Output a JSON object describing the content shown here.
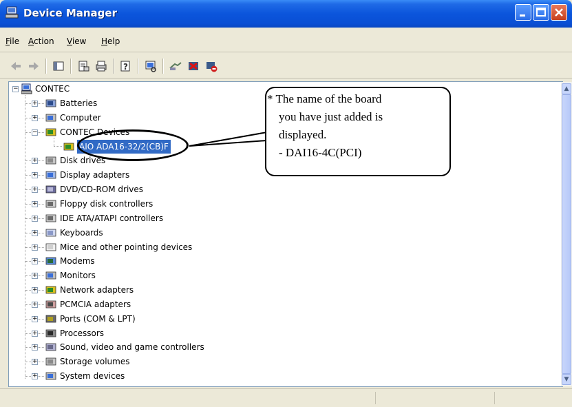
{
  "window": {
    "title": "Device Manager"
  },
  "menu": [
    {
      "label": "File",
      "accel": "F",
      "rest": "ile"
    },
    {
      "label": "Action",
      "accel": "A",
      "rest": "ction"
    },
    {
      "label": "View",
      "accel": "V",
      "rest": "iew"
    },
    {
      "label": "Help",
      "accel": "H",
      "rest": "elp"
    }
  ],
  "tree": {
    "root": "CONTEC",
    "items": [
      {
        "label": "Batteries",
        "icon": "battery-icon",
        "expander": "+"
      },
      {
        "label": "Computer",
        "icon": "computer-icon",
        "expander": "+"
      },
      {
        "label": "CONTEC Devices",
        "icon": "board-icon",
        "expander": "−"
      },
      {
        "label": "AIO ADA16-32/2(CB)F",
        "icon": "board-icon",
        "child": true
      },
      {
        "label": "Disk drives",
        "icon": "disk-icon",
        "expander": "+"
      },
      {
        "label": "Display adapters",
        "icon": "display-icon",
        "expander": "+"
      },
      {
        "label": "DVD/CD-ROM drives",
        "icon": "cdrom-icon",
        "expander": "+"
      },
      {
        "label": "Floppy disk controllers",
        "icon": "controller-icon",
        "expander": "+"
      },
      {
        "label": "IDE ATA/ATAPI controllers",
        "icon": "controller-icon",
        "expander": "+"
      },
      {
        "label": "Keyboards",
        "icon": "keyboard-icon",
        "expander": "+"
      },
      {
        "label": "Mice and other pointing devices",
        "icon": "mouse-icon",
        "expander": "+"
      },
      {
        "label": "Modems",
        "icon": "modem-icon",
        "expander": "+"
      },
      {
        "label": "Monitors",
        "icon": "monitor-icon",
        "expander": "+"
      },
      {
        "label": "Network adapters",
        "icon": "network-icon",
        "expander": "+"
      },
      {
        "label": "PCMCIA adapters",
        "icon": "pcmcia-icon",
        "expander": "+"
      },
      {
        "label": "Ports (COM & LPT)",
        "icon": "port-icon",
        "expander": "+"
      },
      {
        "label": "Processors",
        "icon": "processor-icon",
        "expander": "+"
      },
      {
        "label": "Sound, video and game controllers",
        "icon": "sound-icon",
        "expander": "+"
      },
      {
        "label": "Storage volumes",
        "icon": "storage-icon",
        "expander": "+"
      },
      {
        "label": "System devices",
        "icon": "system-icon",
        "expander": "+"
      }
    ]
  },
  "callout": {
    "lines": [
      "* The name of the board",
      "you have just added is",
      "displayed.",
      "- DAI16-4C(PCI)"
    ]
  },
  "colors": {
    "titlebar": "#0a4fd4",
    "selection": "#316ac5",
    "window_bg": "#ece9d8"
  }
}
